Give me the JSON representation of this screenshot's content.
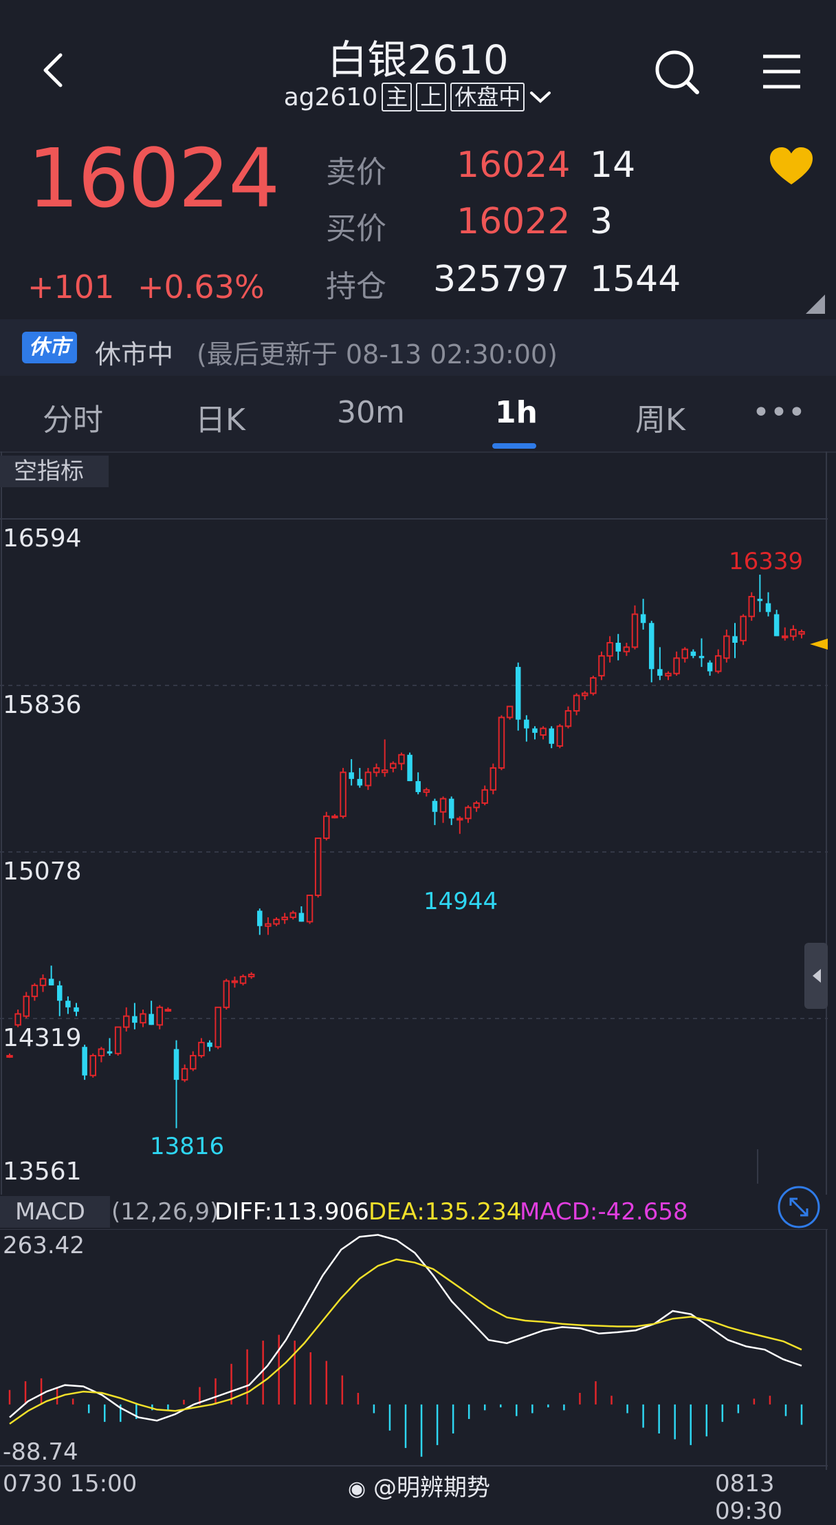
{
  "header": {
    "title": "白银2610",
    "code": "ag2610",
    "tags": [
      "主",
      "上",
      "休盘中"
    ]
  },
  "quote": {
    "price": "16024",
    "change": "+101",
    "change_pct": "+0.63%",
    "ask_label": "卖价",
    "ask_price": "16024",
    "ask_vol": "14",
    "bid_label": "买价",
    "bid_price": "16022",
    "bid_vol": "3",
    "oi_label": "持仓",
    "oi_value": "325797",
    "oi_change": "1544"
  },
  "status": {
    "badge": "休市",
    "state": "休市中",
    "updated": "(最后更新于 08-13 02:30:00)"
  },
  "tabs": [
    "分时",
    "日K",
    "30m",
    "1h",
    "周K",
    "•••"
  ],
  "active_tab": "1h",
  "indicator_label": "空指标",
  "chart_data": {
    "type": "candlestick",
    "y_labels": [
      "16594",
      "15836",
      "15078",
      "14319",
      "13561"
    ],
    "ylim": [
      13561,
      16594
    ],
    "annotations": {
      "high": "16339",
      "low": "13816",
      "mid_low": "14944"
    },
    "up_color": "#e0262a",
    "down_color": "#2ed6f2",
    "candles": [
      [
        14150,
        14160,
        14140,
        14150
      ],
      [
        14290,
        14360,
        14280,
        14340
      ],
      [
        14330,
        14440,
        14320,
        14420
      ],
      [
        14420,
        14480,
        14400,
        14470
      ],
      [
        14470,
        14520,
        14440,
        14500
      ],
      [
        14500,
        14560,
        14470,
        14470
      ],
      [
        14470,
        14490,
        14330,
        14400
      ],
      [
        14400,
        14420,
        14340,
        14370
      ],
      [
        14370,
        14390,
        14330,
        14350
      ],
      [
        14190,
        14200,
        14040,
        14060
      ],
      [
        14060,
        14160,
        14050,
        14150
      ],
      [
        14150,
        14190,
        14120,
        14180
      ],
      [
        14170,
        14230,
        14150,
        14160
      ],
      [
        14160,
        14280,
        14150,
        14280
      ],
      [
        14280,
        14370,
        14260,
        14330
      ],
      [
        14330,
        14390,
        14270,
        14300
      ],
      [
        14300,
        14360,
        14280,
        14340
      ],
      [
        14340,
        14400,
        14290,
        14290
      ],
      [
        14290,
        14380,
        14270,
        14370
      ],
      [
        14360,
        14370,
        14350,
        14360
      ],
      [
        14180,
        14220,
        13820,
        14040
      ],
      [
        14040,
        14110,
        14030,
        14090
      ],
      [
        14090,
        14170,
        14080,
        14150
      ],
      [
        14150,
        14230,
        14140,
        14210
      ],
      [
        14210,
        14220,
        14170,
        14190
      ],
      [
        14190,
        14370,
        14180,
        14370
      ],
      [
        14370,
        14500,
        14360,
        14490
      ],
      [
        14490,
        14510,
        14460,
        14490
      ],
      [
        14480,
        14520,
        14470,
        14510
      ],
      [
        14510,
        14530,
        14500,
        14520
      ],
      [
        14810,
        14820,
        14700,
        14740
      ],
      [
        14740,
        14780,
        14700,
        14750
      ],
      [
        14750,
        14780,
        14740,
        14770
      ],
      [
        14770,
        14800,
        14750,
        14780
      ],
      [
        14780,
        14810,
        14770,
        14800
      ],
      [
        14800,
        14830,
        14760,
        14760
      ],
      [
        14760,
        14880,
        14750,
        14880
      ],
      [
        14880,
        15140,
        14870,
        15140
      ],
      [
        15140,
        15260,
        15130,
        15240
      ],
      [
        15240,
        15250,
        15230,
        15240
      ],
      [
        15240,
        15460,
        15230,
        15440
      ],
      [
        15440,
        15500,
        15380,
        15410
      ],
      [
        15410,
        15460,
        15370,
        15380
      ],
      [
        15380,
        15460,
        15360,
        15440
      ],
      [
        15440,
        15480,
        15420,
        15460
      ],
      [
        15440,
        15590,
        15420,
        15450
      ],
      [
        15460,
        15490,
        15440,
        15480
      ],
      [
        15480,
        15530,
        15450,
        15520
      ],
      [
        15520,
        15530,
        15400,
        15400
      ],
      [
        15400,
        15440,
        15340,
        15350
      ],
      [
        15350,
        15370,
        15330,
        15360
      ],
      [
        15310,
        15320,
        15200,
        15260
      ],
      [
        15260,
        15330,
        15210,
        15320
      ],
      [
        15320,
        15330,
        15200,
        15230
      ],
      [
        15230,
        15240,
        15160,
        15230
      ],
      [
        15230,
        15290,
        15210,
        15280
      ],
      [
        15280,
        15310,
        15260,
        15300
      ],
      [
        15300,
        15380,
        15290,
        15360
      ],
      [
        15360,
        15480,
        15340,
        15460
      ],
      [
        15460,
        15700,
        15450,
        15690
      ],
      [
        15690,
        15740,
        15680,
        15740
      ],
      [
        15920,
        15940,
        15630,
        15680
      ],
      [
        15680,
        15700,
        15580,
        15640
      ],
      [
        15640,
        15650,
        15590,
        15620
      ],
      [
        15610,
        15650,
        15590,
        15640
      ],
      [
        15640,
        15650,
        15550,
        15570
      ],
      [
        15560,
        15660,
        15550,
        15650
      ],
      [
        15650,
        15740,
        15640,
        15720
      ],
      [
        15720,
        15800,
        15700,
        15790
      ],
      [
        15790,
        15810,
        15770,
        15800
      ],
      [
        15800,
        15880,
        15790,
        15870
      ],
      [
        15880,
        15990,
        15860,
        15970
      ],
      [
        15970,
        16060,
        15940,
        16030
      ],
      [
        16030,
        16070,
        15950,
        15990
      ],
      [
        15990,
        16030,
        15970,
        16010
      ],
      [
        16010,
        16200,
        16000,
        16160
      ],
      [
        16160,
        16230,
        16090,
        16120
      ],
      [
        16120,
        16130,
        15850,
        15910
      ],
      [
        15910,
        16010,
        15860,
        15880
      ],
      [
        15880,
        15900,
        15860,
        15890
      ],
      [
        15890,
        15990,
        15880,
        15960
      ],
      [
        15960,
        16010,
        15940,
        16000
      ],
      [
        15990,
        16000,
        15960,
        15970
      ],
      [
        15970,
        16050,
        15920,
        15960
      ],
      [
        15940,
        15950,
        15880,
        15900
      ],
      [
        15900,
        16000,
        15890,
        15970
      ],
      [
        15960,
        16090,
        15940,
        16060
      ],
      [
        16060,
        16120,
        15960,
        16030
      ],
      [
        16040,
        16160,
        16020,
        16150
      ],
      [
        16150,
        16260,
        16130,
        16240
      ],
      [
        16230,
        16340,
        16170,
        16220
      ],
      [
        16210,
        16260,
        16150,
        16170
      ],
      [
        16160,
        16180,
        16060,
        16060
      ],
      [
        16060,
        16100,
        16040,
        16060
      ],
      [
        16060,
        16110,
        16040,
        16090
      ],
      [
        16070,
        16090,
        16050,
        16080
      ]
    ]
  },
  "macd": {
    "label": "MACD",
    "params": "(12,26,9)",
    "diff": "DIFF:113.906",
    "dea": "DEA:135.234",
    "macd": "MACD:-42.658",
    "y_top": "263.42",
    "y_bottom": "-88.74",
    "diff_color": "#ffffff",
    "dea_color": "#f1e02a",
    "diff_series": [
      -20,
      5,
      20,
      30,
      28,
      15,
      -5,
      -20,
      -25,
      -15,
      0,
      10,
      20,
      30,
      60,
      100,
      150,
      200,
      240,
      260,
      263,
      255,
      235,
      200,
      160,
      130,
      100,
      95,
      105,
      115,
      120,
      118,
      110,
      112,
      115,
      125,
      145,
      140,
      120,
      100,
      90,
      85,
      70,
      60
    ],
    "dea_series": [
      -30,
      -10,
      5,
      15,
      20,
      18,
      10,
      0,
      -8,
      -10,
      -5,
      0,
      8,
      20,
      40,
      65,
      95,
      130,
      165,
      195,
      215,
      225,
      220,
      210,
      190,
      170,
      150,
      135,
      130,
      128,
      125,
      123,
      122,
      121,
      121,
      125,
      133,
      136,
      130,
      120,
      112,
      105,
      98,
      85
    ],
    "hist_series": [
      25,
      40,
      45,
      30,
      10,
      -15,
      -30,
      -30,
      -25,
      -10,
      -10,
      8,
      30,
      45,
      70,
      95,
      110,
      120,
      110,
      90,
      75,
      50,
      20,
      -15,
      -45,
      -75,
      -90,
      -70,
      -50,
      -25,
      -10,
      -5,
      -20,
      -15,
      -5,
      -10,
      20,
      40,
      15,
      -15,
      -40,
      -50,
      -60,
      -70,
      -55,
      -30,
      -15,
      10,
      15,
      -20,
      -35
    ]
  },
  "axis": {
    "start": "0730 15:00",
    "end": "0813 09:30"
  },
  "watermark": "@明辨期势"
}
